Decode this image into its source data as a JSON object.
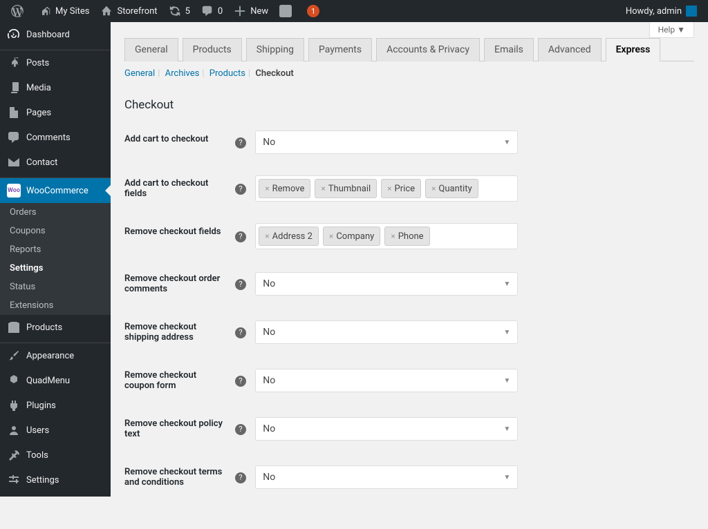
{
  "adminbar": {
    "mysites": "My Sites",
    "sitename": "Storefront",
    "updates": "5",
    "comments": "0",
    "new": "New",
    "notif": "1",
    "howdy": "Howdy, admin"
  },
  "sidebar": {
    "dashboard": "Dashboard",
    "posts": "Posts",
    "media": "Media",
    "pages": "Pages",
    "comments": "Comments",
    "contact": "Contact",
    "woocommerce": "WooCommerce",
    "sub": {
      "orders": "Orders",
      "coupons": "Coupons",
      "reports": "Reports",
      "settings": "Settings",
      "status": "Status",
      "extensions": "Extensions"
    },
    "products": "Products",
    "appearance": "Appearance",
    "quadmenu": "QuadMenu",
    "plugins": "Plugins",
    "users": "Users",
    "tools": "Tools",
    "settings": "Settings"
  },
  "help": "Help ▼",
  "tabs": {
    "general": "General",
    "products": "Products",
    "shipping": "Shipping",
    "payments": "Payments",
    "accounts": "Accounts & Privacy",
    "emails": "Emails",
    "advanced": "Advanced",
    "express": "Express"
  },
  "subnav": {
    "general": "General",
    "archives": "Archives",
    "products": "Products",
    "checkout": "Checkout"
  },
  "section_title": "Checkout",
  "fields": {
    "add_cart": {
      "label": "Add cart to checkout",
      "value": "No"
    },
    "add_cart_fields": {
      "label": "Add cart to checkout fields",
      "tags": [
        "Remove",
        "Thumbnail",
        "Price",
        "Quantity"
      ]
    },
    "remove_fields": {
      "label": "Remove checkout fields",
      "tags": [
        "Address 2",
        "Company",
        "Phone"
      ]
    },
    "remove_order_comments": {
      "label": "Remove checkout order comments",
      "value": "No"
    },
    "remove_shipping": {
      "label": "Remove checkout shipping address",
      "value": "No"
    },
    "remove_coupon": {
      "label": "Remove checkout coupon form",
      "value": "No"
    },
    "remove_policy": {
      "label": "Remove checkout policy text",
      "value": "No"
    },
    "remove_terms": {
      "label": "Remove checkout terms and conditions",
      "value": "No"
    }
  }
}
